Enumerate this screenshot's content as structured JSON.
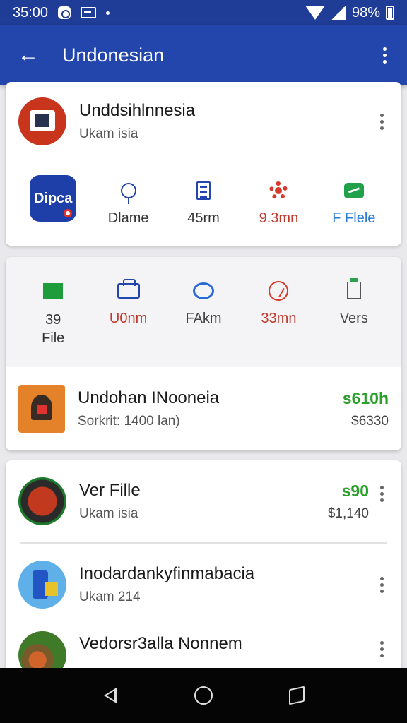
{
  "status_bar": {
    "time": "35:00",
    "battery": "98%"
  },
  "app_bar": {
    "title": "Undonesian"
  },
  "card1": {
    "header": {
      "title": "Unddsihlnnesia",
      "subtitle": "Ukam isia"
    },
    "actions": [
      {
        "label": "Dipca",
        "icon": "app-logo-icon"
      },
      {
        "label": "Dlame",
        "icon": "pin-icon",
        "color": "#333333"
      },
      {
        "label": "45rm",
        "icon": "document-icon",
        "color": "#333333"
      },
      {
        "label": "9.3mn",
        "icon": "gear-icon",
        "color": "#c0392b"
      },
      {
        "label": "F Flele",
        "icon": "green-tag-icon",
        "color": "#2a7bd6"
      }
    ]
  },
  "card2": {
    "actions": [
      {
        "label": "39\nFile",
        "icon": "green-box-icon",
        "color": "#333333"
      },
      {
        "label": "U0nm",
        "icon": "folder-icon",
        "color": "#c0392b"
      },
      {
        "label": "FAkm",
        "icon": "oval-icon",
        "color": "#444444"
      },
      {
        "label": "33mn",
        "icon": "red-circle-icon",
        "color": "#c0392b"
      },
      {
        "label": "Vers",
        "icon": "flask-icon",
        "color": "#444444"
      }
    ],
    "item": {
      "title": "Undohan INooneia",
      "subtitle": "Sorkrit: 1400 lan)",
      "price": "s610h",
      "price_sub": "$6330"
    }
  },
  "card3": {
    "items": [
      {
        "title": "Ver Fille",
        "subtitle": "Ukam isia",
        "price": "s90",
        "price_sub": "$1,140"
      },
      {
        "title": "Inodardankyfinmabacia",
        "subtitle": "Ukam 214"
      },
      {
        "title": "Vedorsr3alla Nonnem"
      }
    ]
  },
  "colors": {
    "app_bar": "#2346ad",
    "status_bar": "#1f3c96",
    "price_green": "#2aa02a"
  }
}
